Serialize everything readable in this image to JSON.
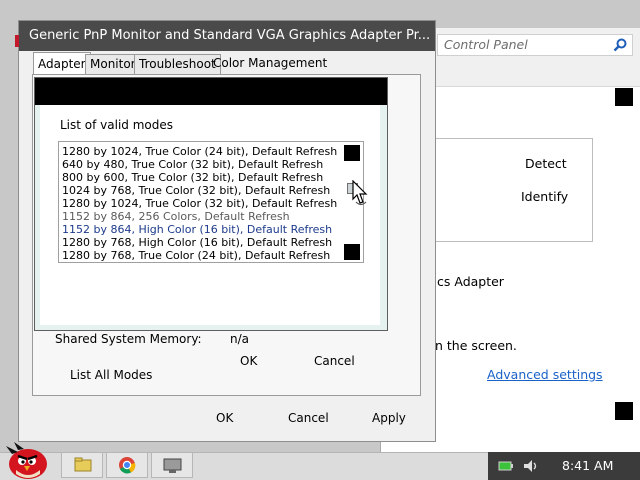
{
  "window": {
    "title": "Generic PnP Monitor and Standard VGA Graphics Adapter Pr..."
  },
  "tabs": [
    {
      "label": "Adapter",
      "active": true
    },
    {
      "label": "Monitor"
    },
    {
      "label": "Troubleshoot"
    },
    {
      "label": "Color Management"
    }
  ],
  "adapter_info": {
    "shared_memory_label": "Shared System Memory:",
    "shared_memory_value": "n/a",
    "list_all_modes": "List All Modes"
  },
  "properties_buttons": {
    "ok": "OK",
    "cancel": "Cancel",
    "apply": "Apply"
  },
  "modes_dialog": {
    "label": "List of valid modes",
    "modes": [
      "1280 by 1024, True Color (24 bit), Default Refresh",
      "640 by 480, True Color (32 bit), Default Refresh",
      "800 by 600, True Color (32 bit), Default Refresh",
      "1024 by 768, True Color (32 bit), Default Refresh",
      "1280 by 1024, True Color (32 bit), Default Refresh",
      "1152 by 864, 256 Colors, Default Refresh",
      "1152 by 864, High Color (16 bit), Default Refresh",
      "1280 by 768, High Color (16 bit), Default Refresh",
      "1280 by 768, True Color (24 bit), Default Refresh"
    ],
    "ok": "OK",
    "cancel": "Cancel"
  },
  "control_panel": {
    "search_placeholder": "Control Panel",
    "detect": "Detect",
    "identify": "Identify",
    "adapter_fragment": "cs Adapter",
    "screen_fragment": "n the screen.",
    "advanced_settings": "Advanced settings"
  },
  "taskbar": {
    "clock": "8:41 AM"
  }
}
